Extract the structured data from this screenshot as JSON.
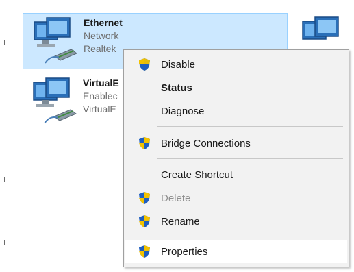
{
  "adapters": [
    {
      "name": "Ethernet",
      "line1": "Network",
      "line2": "Realtek",
      "selected": true
    },
    {
      "name": "VirtualE",
      "line1": "Enablec",
      "line2": "VirtualE",
      "selected": false
    }
  ],
  "menu": {
    "items": [
      {
        "label": "Disable",
        "icon": "shield-icon",
        "style": "normal"
      },
      {
        "label": "Status",
        "icon": "",
        "style": "bold"
      },
      {
        "label": "Diagnose",
        "icon": "",
        "style": "normal"
      },
      {
        "label": "Bridge Connections",
        "icon": "shield-icon",
        "style": "normal"
      },
      {
        "label": "Create Shortcut",
        "icon": "",
        "style": "normal"
      },
      {
        "label": "Delete",
        "icon": "shield-icon",
        "style": "disabled"
      },
      {
        "label": "Rename",
        "icon": "shield-icon",
        "style": "normal"
      },
      {
        "label": "Properties",
        "icon": "shield-icon",
        "style": "hover"
      }
    ]
  },
  "colors": {
    "selection_bg": "#cce8ff",
    "menu_bg": "#f2f2f2",
    "shield_blue": "#1f5fbf",
    "shield_yellow": "#f2c200"
  }
}
